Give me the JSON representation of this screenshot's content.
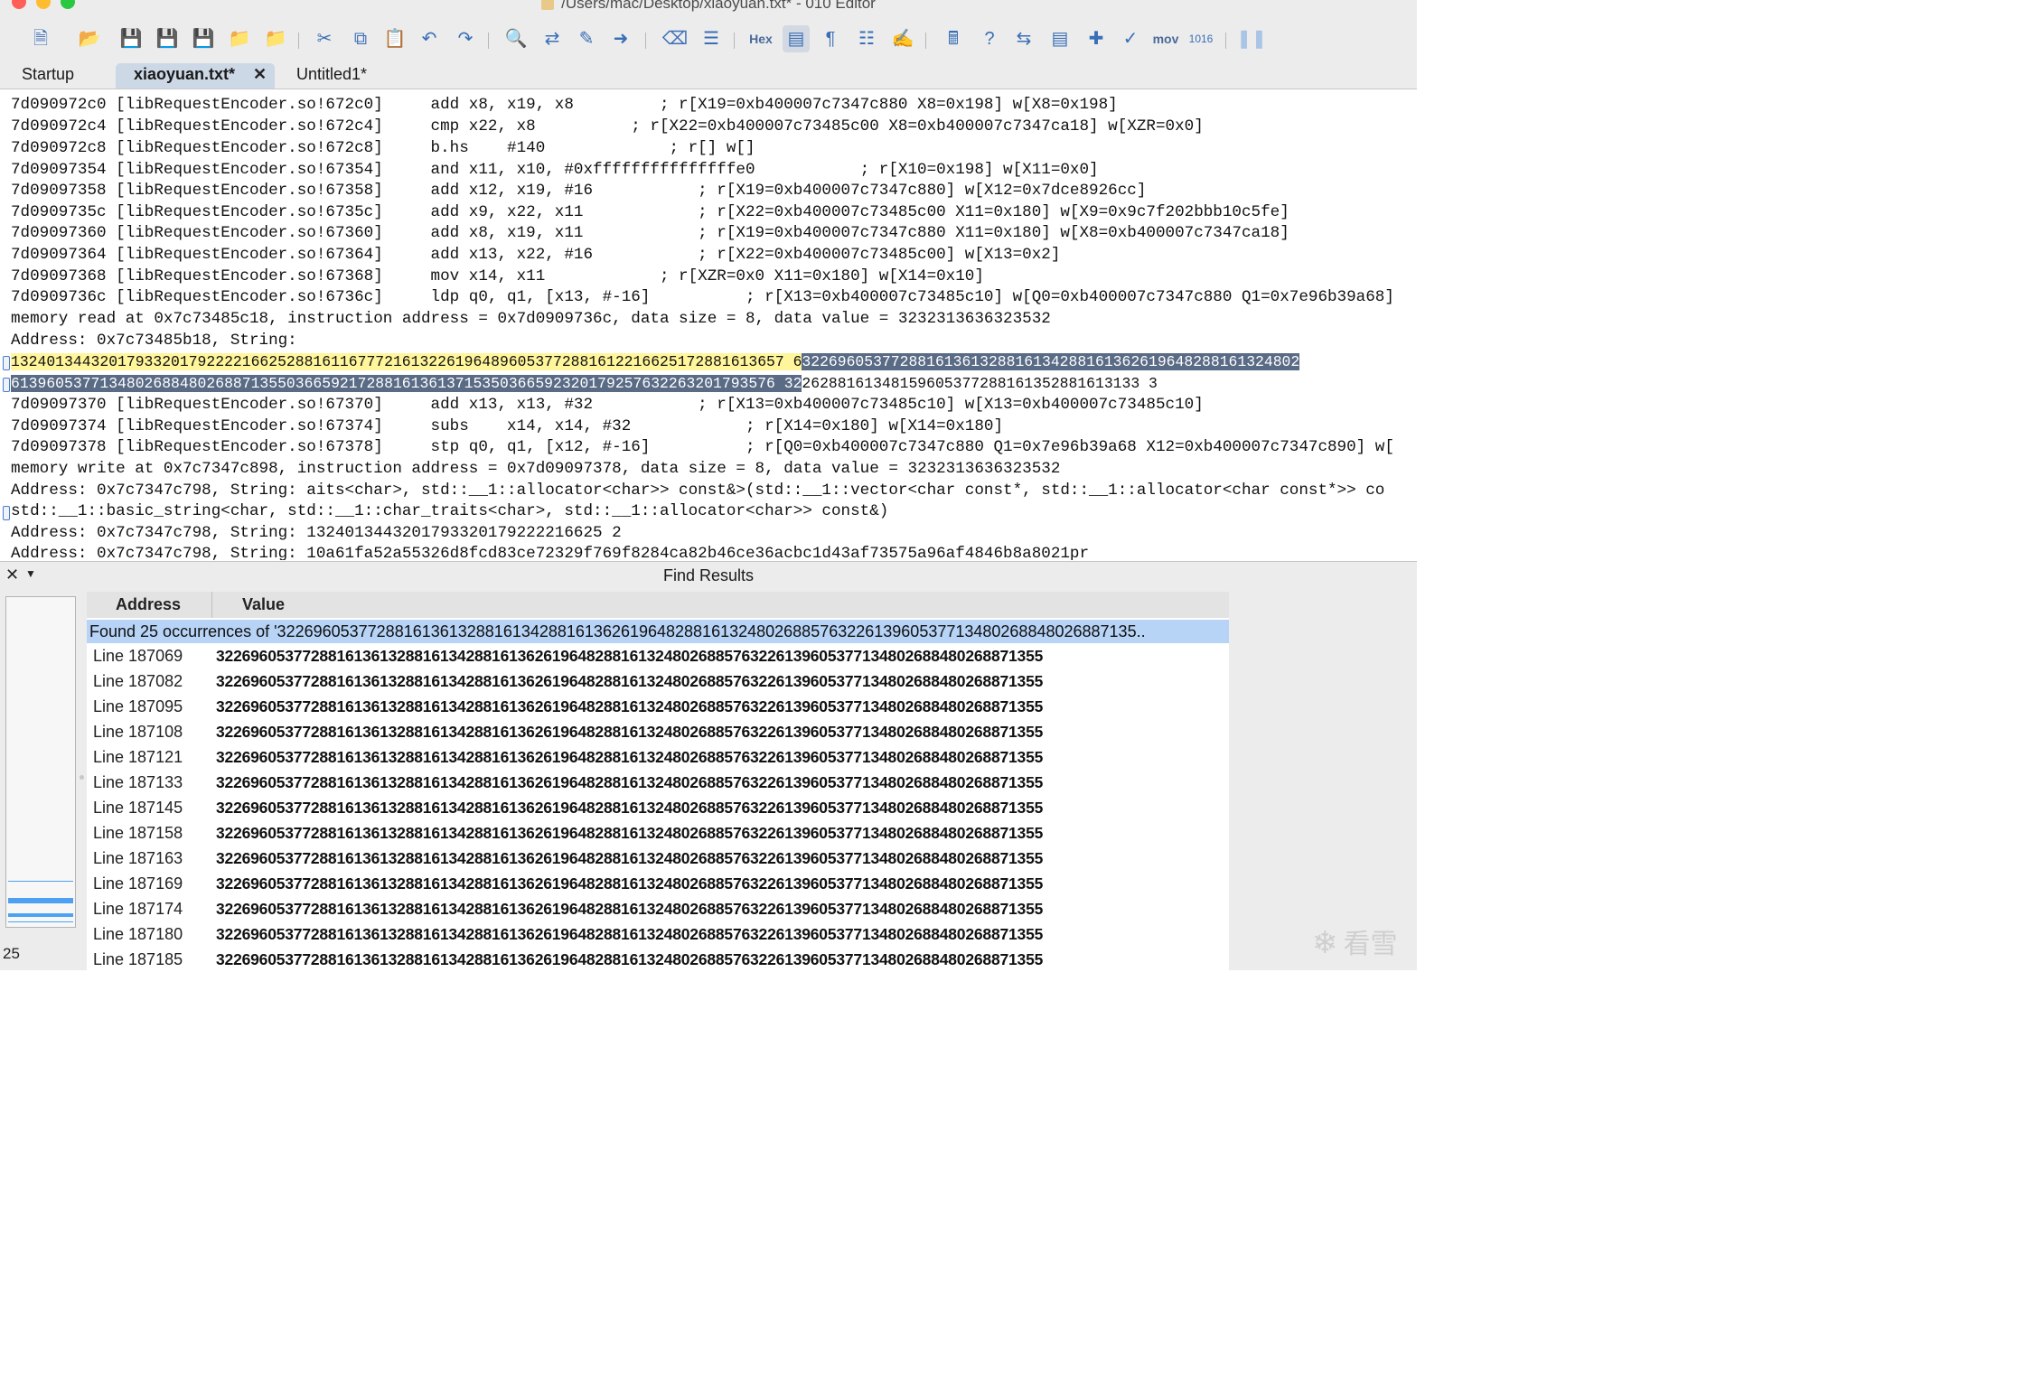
{
  "window": {
    "title": "/Users/mac/Desktop/xiaoyuan.txt* - 010 Editor"
  },
  "toolbar": {
    "hex_label": "Hex",
    "mov_label": "mov"
  },
  "tabs": [
    {
      "label": "Startup"
    },
    {
      "label": "xiaoyuan.txt*"
    },
    {
      "label": "Untitled1*"
    }
  ],
  "editor": {
    "lines": [
      "7d090972c0 [libRequestEncoder.so!672c0]     add x8, x19, x8         ; r[X19=0xb400007c7347c880 X8=0x198] w[X8=0x198]",
      "7d090972c4 [libRequestEncoder.so!672c4]     cmp x22, x8          ; r[X22=0xb400007c73485c00 X8=0xb400007c7347ca18] w[XZR=0x0]",
      "7d090972c8 [libRequestEncoder.so!672c8]     b.hs    #140             ; r[] w[]",
      "7d09097354 [libRequestEncoder.so!67354]     and x11, x10, #0xfffffffffffffffe0           ; r[X10=0x198] w[X11=0x0]",
      "7d09097358 [libRequestEncoder.so!67358]     add x12, x19, #16           ; r[X19=0xb400007c7347c880] w[X12=0x7dce8926cc]",
      "7d0909735c [libRequestEncoder.so!6735c]     add x9, x22, x11            ; r[X22=0xb400007c73485c00 X11=0x180] w[X9=0x9c7f202bbb10c5fe]",
      "7d09097360 [libRequestEncoder.so!67360]     add x8, x19, x11            ; r[X19=0xb400007c7347c880 X11=0x180] w[X8=0xb400007c7347ca18]",
      "7d09097364 [libRequestEncoder.so!67364]     add x13, x22, #16           ; r[X22=0xb400007c73485c00] w[X13=0x2]",
      "7d09097368 [libRequestEncoder.so!67368]     mov x14, x11            ; r[XZR=0x0 X11=0x180] w[X14=0x10]",
      "7d0909736c [libRequestEncoder.so!6736c]     ldp q0, q1, [x13, #-16]          ; r[X13=0xb400007c73485c10] w[Q0=0xb400007c7347c880 Q1=0x7e96b39a68]",
      "memory read at 0x7c73485c18, instruction address = 0x7d0909736c, data size = 8, data value = 3232313636323532",
      "Address: 0x7c73485b18, String:",
      "",
      "",
      "7d09097370 [libRequestEncoder.so!67370]     add x13, x13, #32           ; r[X13=0xb400007c73485c10] w[X13=0xb400007c73485c10]",
      "7d09097374 [libRequestEncoder.so!67374]     subs    x14, x14, #32            ; r[X14=0x180] w[X14=0x180]",
      "7d09097378 [libRequestEncoder.so!67378]     stp q0, q1, [x12, #-16]          ; r[Q0=0xb400007c7347c880 Q1=0x7e96b39a68 X12=0xb400007c7347c890] w[",
      "memory write at 0x7c7347c898, instruction address = 0x7d09097378, data size = 8, data value = 3232313636323532",
      "Address: 0x7c7347c798, String: aits<char>, std::__1::allocator<char>> const&>(std::__1::vector<char const*, std::__1::allocator<char const*>> co",
      "std::__1::basic_string<char, std::__1::char_traits<char>, std::__1::allocator<char>> const&)",
      "Address: 0x7c7347c798, String: 1324013443201793320179222216625 2",
      "Address: 0x7c7347c798, String: 10a61fa52a55326d8fcd83ce72329f769f8284ca82b46ce36acbc1d43af73575a96af4846b8a8021pr"
    ],
    "hl1_yellow": "132401344320179332017922221662528816116777216132261964896053772881612216625172881613657 6",
    "hl1_blue": "32269605377288161361328816134288161362619648288161324802",
    "hl2_blue": "61396053771348026884802688713550366592172881613613715350366592320179257632263201793576 32",
    "hl2_plain": "26288161348159605377288161352881613133 3"
  },
  "find": {
    "title": "Find Results",
    "col_address": "Address",
    "col_value": "Value",
    "summary": "Found 25 occurrences of '32269605377288161361328816134288161362619648288161324802688576322613960537713480268848026887135..",
    "count": "25",
    "rows": [
      {
        "address": "Line 187069",
        "value": "322696053772881613613288161342881613626196482881613248026885763226139605377134802688480268871355"
      },
      {
        "address": "Line 187082",
        "value": "322696053772881613613288161342881613626196482881613248026885763226139605377134802688480268871355"
      },
      {
        "address": "Line 187095",
        "value": "322696053772881613613288161342881613626196482881613248026885763226139605377134802688480268871355"
      },
      {
        "address": "Line 187108",
        "value": "322696053772881613613288161342881613626196482881613248026885763226139605377134802688480268871355"
      },
      {
        "address": "Line 187121",
        "value": "322696053772881613613288161342881613626196482881613248026885763226139605377134802688480268871355"
      },
      {
        "address": "Line 187133",
        "value": "322696053772881613613288161342881613626196482881613248026885763226139605377134802688480268871355"
      },
      {
        "address": "Line 187145",
        "value": "322696053772881613613288161342881613626196482881613248026885763226139605377134802688480268871355"
      },
      {
        "address": "Line 187158",
        "value": "322696053772881613613288161342881613626196482881613248026885763226139605377134802688480268871355"
      },
      {
        "address": "Line 187163",
        "value": "322696053772881613613288161342881613626196482881613248026885763226139605377134802688480268871355"
      },
      {
        "address": "Line 187169",
        "value": "322696053772881613613288161342881613626196482881613248026885763226139605377134802688480268871355"
      },
      {
        "address": "Line 187174",
        "value": "322696053772881613613288161342881613626196482881613248026885763226139605377134802688480268871355"
      },
      {
        "address": "Line 187180",
        "value": "322696053772881613613288161342881613626196482881613248026885763226139605377134802688480268871355"
      },
      {
        "address": "Line 187185",
        "value": "322696053772881613613288161342881613626196482881613248026885763226139605377134802688480268871355"
      }
    ]
  },
  "watermark": {
    "text": "看雪"
  },
  "icons": [
    "new-file-icon",
    "open-folder-icon",
    "save-icon",
    "save-as-icon",
    "save-all-icon",
    "workspace-icon",
    "project-icon",
    "cut-icon",
    "copy-icon",
    "paste-icon",
    "undo-icon",
    "redo-icon",
    "find-icon",
    "replace-icon",
    "find-in-files-icon",
    "goto-icon",
    "bookmark-icon",
    "bookmark-list-icon",
    "hex-operations-icon",
    "text-mode-icon",
    "show-whitespace-icon",
    "column-mode-icon",
    "highlight-icon",
    "calculator-icon",
    "help-icon",
    "compare-icon",
    "histogram-icon",
    "checksum-icon",
    "templates-icon",
    "scripts-icon",
    "convert-base-icon",
    "pause-icon",
    "close-icon",
    "menu-icon",
    "snowflake-icon"
  ],
  "colors": {
    "highlight_yellow": "#fff59a",
    "highlight_blue": "#5a6b86",
    "summary_row": "#b7d3f6",
    "overview_marker": "#4ea1f2",
    "traffic_red": "#ff5f57",
    "traffic_yellow": "#febc2e",
    "traffic_green": "#28c840"
  }
}
